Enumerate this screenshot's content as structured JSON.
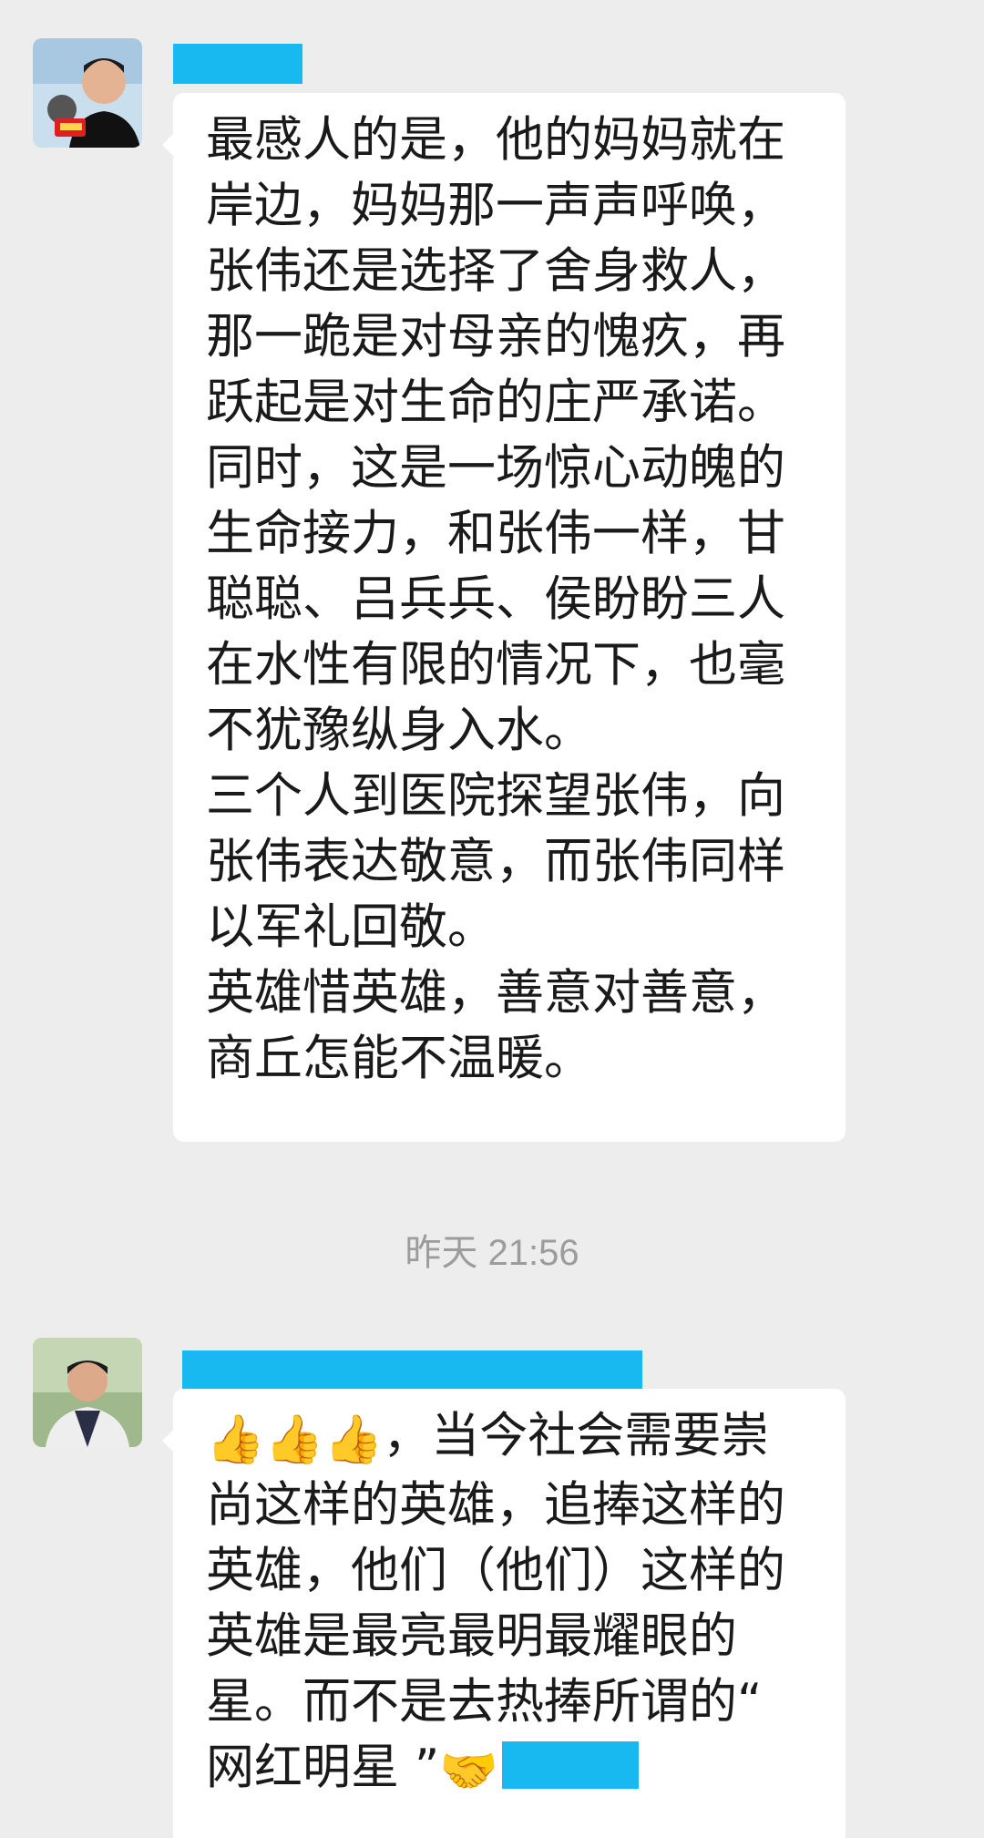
{
  "messages": [
    {
      "sender_name_visible": false,
      "avatar": "avatar-man-with-microphone",
      "lines": [
        "最感人的是，他的妈妈就在",
        "岸边，妈妈那一声声呼唤，",
        "张伟还是选择了舍身救人，",
        "那一跪是对母亲的愧疚，再",
        "跃起是对生命的庄严承诺。",
        "同时，这是一场惊心动魄的",
        "生命接力，和张伟一样，甘",
        "聪聪、吕兵兵、侯盼盼三人",
        "在水性有限的情况下，也毫",
        "不犹豫纵身入水。",
        "三个人到医院探望张伟，向",
        "张伟表达敬意，而张伟同样",
        "以军礼回敬。",
        "英雄惜英雄，善意对善意，",
        "商丘怎能不温暖。"
      ]
    },
    {
      "sender_name_visible": false,
      "avatar": "avatar-man-outdoors",
      "emojis": [
        "👍",
        "👍",
        "👍"
      ],
      "lines": [
        "，当今社会需要崇",
        "尚这样的英雄，追捧这样的",
        "英雄，他们（他们）这样的",
        "英雄是最亮最明最耀眼的",
        "星。而不是去热捧所谓的“",
        "网红明星 ”"
      ],
      "handshake_emoji": "🤝"
    }
  ],
  "timestamp": "昨天 21:56",
  "colors": {
    "background": "#ededed",
    "bubble": "#ffffff",
    "redaction": "#18b9f0",
    "timestamp": "#9c9c9c"
  }
}
